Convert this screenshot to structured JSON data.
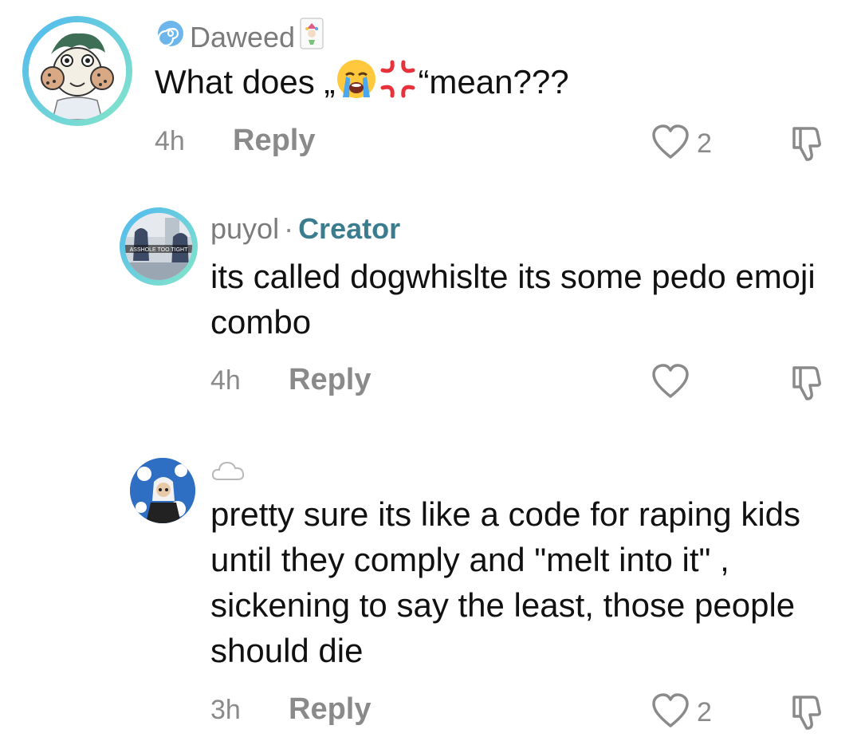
{
  "comments": [
    {
      "username": "Daweed",
      "text_before": "What does „",
      "text_after": "“mean???",
      "emojis": [
        "loudly-crying-face",
        "anger-symbol"
      ],
      "time": "4h",
      "reply_label": "Reply",
      "likes": "2",
      "ring_colors": [
        "#5bc8f5",
        "#7be0c8"
      ]
    },
    {
      "username": "puyol",
      "separator": "·",
      "badge": "Creator",
      "text": "its called dogwhislte its some pedo emoji combo",
      "time": "4h",
      "reply_label": "Reply",
      "likes": "",
      "ring_colors": [
        "#5bc8f5",
        "#7be0c8"
      ]
    },
    {
      "username": "",
      "name_icon": "cloud-icon",
      "text": "pretty sure its like a code for raping kids until they comply and \"melt into it\" , sickening to say the least, those people should die",
      "time": "3h",
      "reply_label": "Reply",
      "likes": "2"
    }
  ],
  "colors": {
    "meta_gray": "#8a8a8a",
    "creator_teal": "#3b7d8f"
  }
}
